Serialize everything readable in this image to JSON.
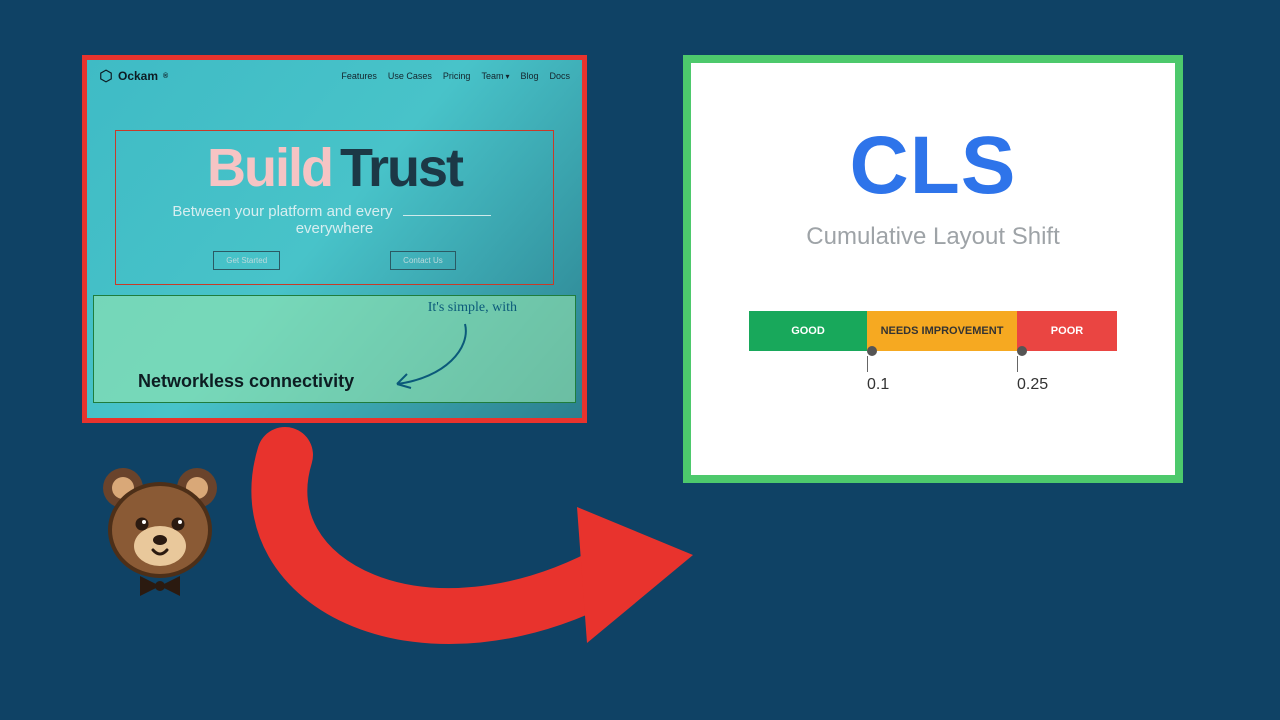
{
  "left": {
    "brand": "Ockam",
    "nav": [
      "Features",
      "Use Cases",
      "Pricing",
      "Team",
      "Blog",
      "Docs"
    ],
    "hero": {
      "word1": "Build",
      "word2": "Trust",
      "sub_pre": "Between your platform and every",
      "sub_post": "everywhere",
      "btn_primary": "Get Started",
      "btn_secondary": "Contact Us"
    },
    "simple": "It's simple, with",
    "networkless": "Networkless connectivity"
  },
  "right": {
    "title": "CLS",
    "subtitle": "Cumulative Layout Shift",
    "segments": {
      "good": "GOOD",
      "needs": "NEEDS IMPROVEMENT",
      "poor": "POOR"
    },
    "thresholds": {
      "t1": "0.1",
      "t2": "0.25"
    }
  },
  "colors": {
    "bg": "#0f4265",
    "red": "#e8332d",
    "green_border": "#4dc96c",
    "blue_text": "#2e74ea",
    "seg_good": "#18a85b",
    "seg_needs": "#f6a921",
    "seg_poor": "#ea4542"
  }
}
